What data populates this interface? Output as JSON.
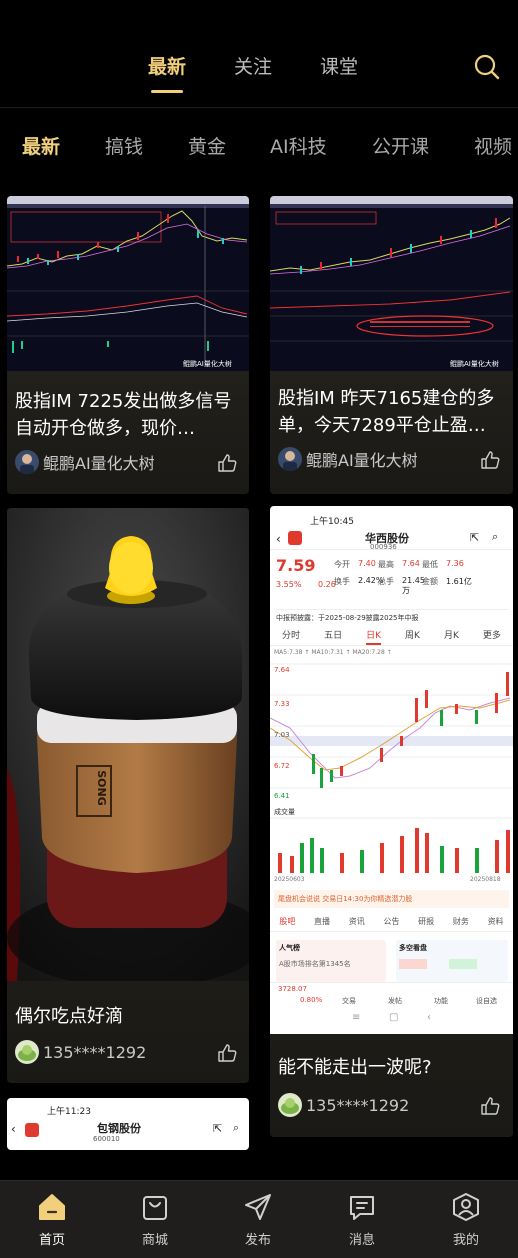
{
  "top_tabs": [
    {
      "label": "最新",
      "active": true
    },
    {
      "label": "关注",
      "active": false
    },
    {
      "label": "课堂",
      "active": false
    }
  ],
  "categories": [
    {
      "label": "最新",
      "active": true
    },
    {
      "label": "搞钱"
    },
    {
      "label": "黄金"
    },
    {
      "label": "AI科技"
    },
    {
      "label": "公开课"
    },
    {
      "label": "视频"
    }
  ],
  "cards": [
    {
      "title": "股指IM 7225发出做多信号自动开仓做多，现价…",
      "author": "鲲鹏AI量化大树",
      "watermark": "鲲鹏AI量化大树"
    },
    {
      "title": "股指IM 昨天7165建仓的多单，今天7289平仓止盈…",
      "author": "鲲鹏AI量化大树",
      "watermark": "鲲鹏AI量化大树"
    },
    {
      "title": "偶尔吃点好滴",
      "author": "135****1292",
      "cup_text": "SONG"
    },
    {
      "title": "能不能走出一波呢?",
      "author": "135****1292"
    }
  ],
  "stock_shot": {
    "time": "上午10:45",
    "name": "华西股份",
    "code": "000936",
    "price": "7.59",
    "change_pct": "3.55%",
    "change": "0.26",
    "open_label": "今开",
    "open": "7.40",
    "high_label": "最高",
    "high": "7.64",
    "low_label": "最低",
    "low": "7.36",
    "turnover_label": "换手",
    "turnover": "2.42%",
    "volume_label": "总手",
    "volume": "21.45万",
    "amount_label": "金额",
    "amount": "1.61亿",
    "notice": "中报预披露：于2025-08-29披露2025年中报",
    "period_tabs": [
      "分时",
      "五日",
      "日K",
      "周K",
      "月K",
      "更多"
    ],
    "y_labels": [
      "7.64",
      "7.33",
      "7.03",
      "6.72",
      "6.41"
    ],
    "ma_line": "MA5:7.38 ↑ MA10:7.31 ↑ MA20:7.28 ↑",
    "vol_label": "成交量",
    "dates": [
      "20250603",
      "20250818"
    ],
    "banner": "尾盘机会说说 交易日14:30为你精选潜力股",
    "bottom_tabs": [
      "股吧",
      "直播",
      "资讯",
      "公告",
      "研报",
      "财务",
      "资料"
    ],
    "hot_label": "人气榜",
    "hot_text": "A股市场排名第1345名",
    "bull_label": "多空看盘",
    "index_value": "3728.07",
    "index_change": "0.80%",
    "action_items": [
      "交易",
      "发帖",
      "功能",
      "设自选"
    ]
  },
  "partial_shot": {
    "time": "上午11:23",
    "name": "包钢股份",
    "code": "600010"
  },
  "bottom_nav": [
    {
      "label": "首页",
      "icon": "home-icon",
      "active": true
    },
    {
      "label": "商城",
      "icon": "shopping-bag-icon"
    },
    {
      "label": "发布",
      "icon": "paper-plane-icon"
    },
    {
      "label": "消息",
      "icon": "message-icon"
    },
    {
      "label": "我的",
      "icon": "profile-icon"
    }
  ],
  "colors": {
    "accent": "#f1cf7c",
    "background": "#000000",
    "card": "#2a2823",
    "up": "#e03a2e",
    "down": "#1aa33a"
  }
}
